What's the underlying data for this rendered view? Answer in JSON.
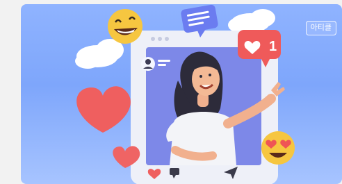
{
  "illustration": {
    "description_icon": "social-media-woman-illustration"
  },
  "badge": {
    "label": "아티클"
  },
  "notification": {
    "count": "1"
  },
  "colors": {
    "card_bg_top": "#8fb3ff",
    "card_bg_bottom": "#a7c4ff",
    "heart": "#ef5f5f",
    "notification": "#ef5a5a"
  }
}
